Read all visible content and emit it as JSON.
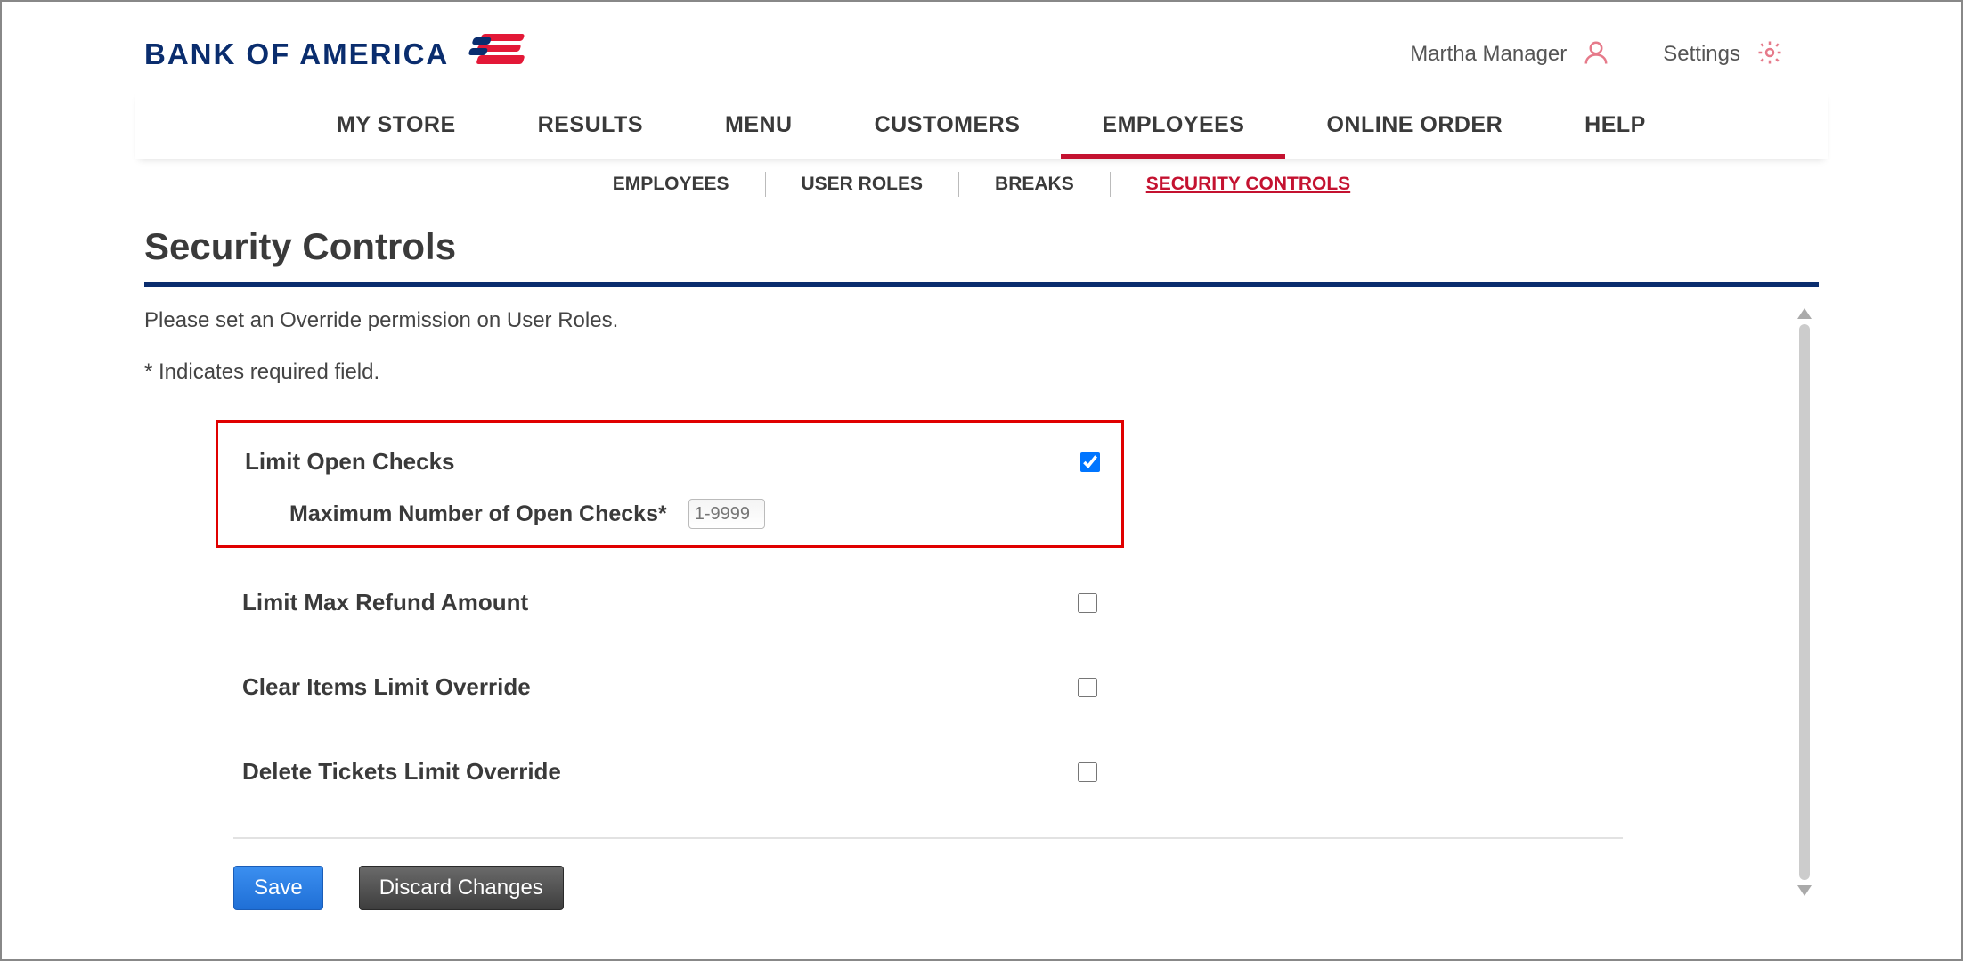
{
  "header": {
    "brand_text": "BANK OF AMERICA",
    "user_name": "Martha Manager",
    "settings_label": "Settings"
  },
  "main_nav": [
    {
      "label": "MY STORE",
      "active": false
    },
    {
      "label": "RESULTS",
      "active": false
    },
    {
      "label": "MENU",
      "active": false
    },
    {
      "label": "CUSTOMERS",
      "active": false
    },
    {
      "label": "EMPLOYEES",
      "active": true
    },
    {
      "label": "ONLINE ORDER",
      "active": false
    },
    {
      "label": "HELP",
      "active": false
    }
  ],
  "sub_nav": [
    {
      "label": "EMPLOYEES",
      "active": false
    },
    {
      "label": "USER ROLES",
      "active": false
    },
    {
      "label": "BREAKS",
      "active": false
    },
    {
      "label": "SECURITY CONTROLS",
      "active": true
    }
  ],
  "page": {
    "title": "Security Controls",
    "intro": "Please set an Override permission on User Roles.",
    "required_note": "* Indicates required field."
  },
  "controls": {
    "limit_open_checks": {
      "label": "Limit Open Checks",
      "checked": true,
      "subfield_label": "Maximum Number of Open Checks*",
      "subfield_placeholder": "1-9999",
      "subfield_value": ""
    },
    "limit_max_refund": {
      "label": "Limit Max Refund Amount",
      "checked": false
    },
    "clear_items_override": {
      "label": "Clear Items Limit Override",
      "checked": false
    },
    "delete_tickets_override": {
      "label": "Delete Tickets Limit Override",
      "checked": false
    }
  },
  "buttons": {
    "save": "Save",
    "discard": "Discard Changes"
  }
}
